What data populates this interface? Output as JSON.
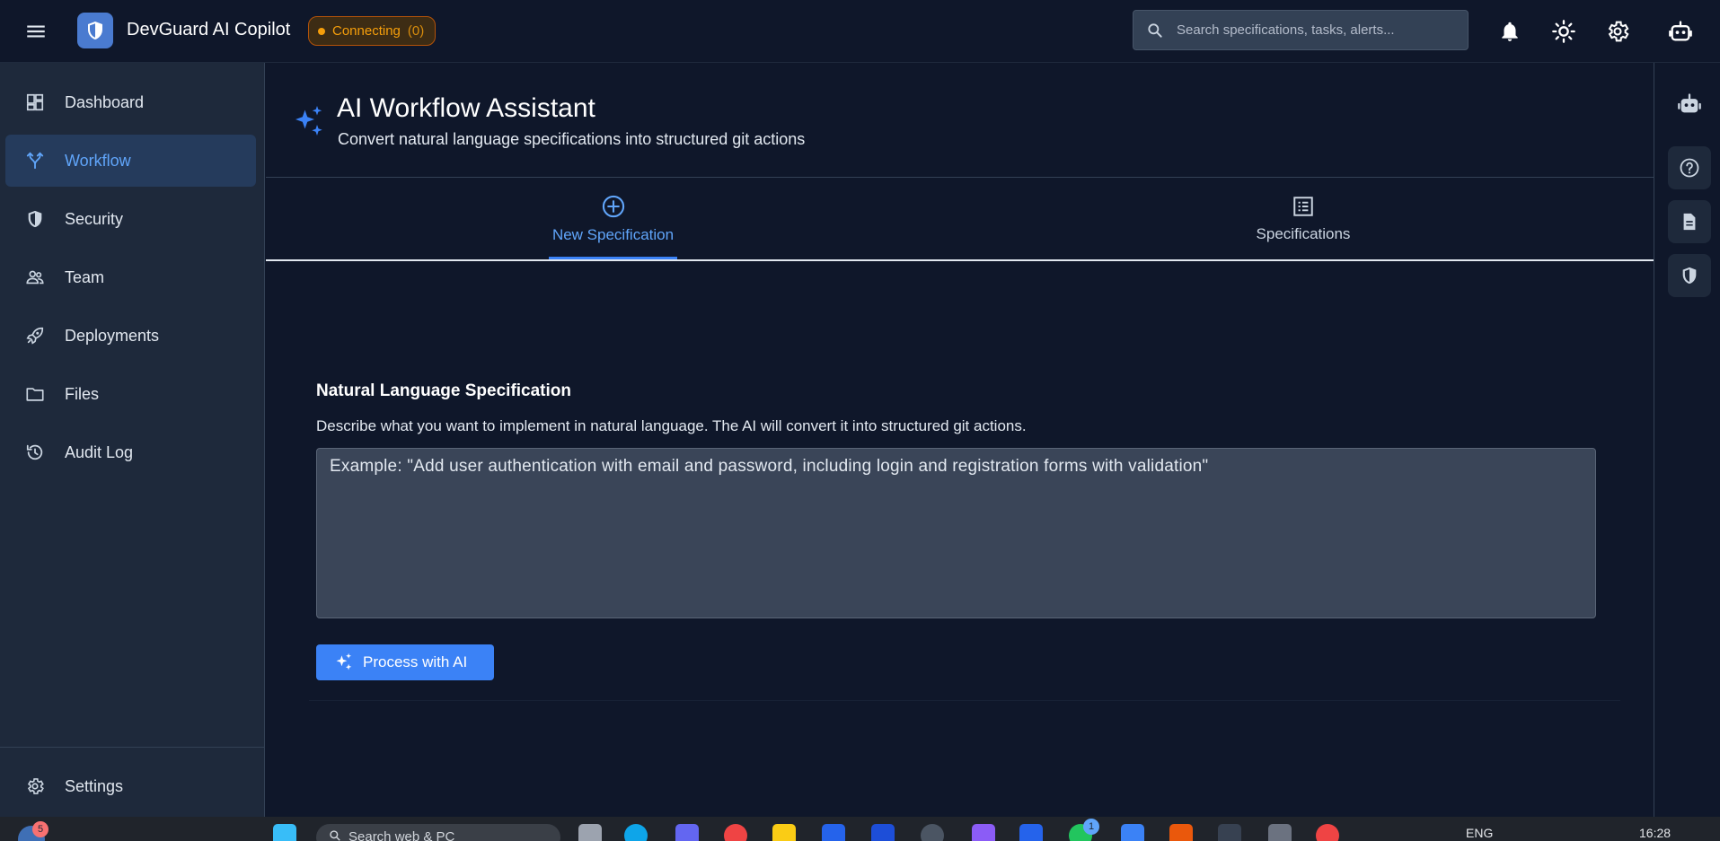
{
  "app": {
    "title": "DevGuard AI Copilot",
    "connection_status": "Connecting",
    "connection_count": "(0)"
  },
  "search": {
    "placeholder": "Search specifications, tasks, alerts..."
  },
  "topbar_icons": [
    "menu-icon",
    "shield-logo-icon",
    "bell-icon",
    "sun-icon",
    "gear-icon",
    "robot-icon"
  ],
  "sidebar": {
    "items": [
      {
        "label": "Dashboard",
        "icon": "dashboard-icon"
      },
      {
        "label": "Workflow",
        "icon": "merge-icon",
        "active": true
      },
      {
        "label": "Security",
        "icon": "shield-icon"
      },
      {
        "label": "Team",
        "icon": "people-icon"
      },
      {
        "label": "Deployments",
        "icon": "rocket-icon"
      },
      {
        "label": "Files",
        "icon": "folder-icon"
      },
      {
        "label": "Audit Log",
        "icon": "history-icon"
      }
    ],
    "settings_label": "Settings"
  },
  "right_rail": [
    "robot-icon",
    "help-icon",
    "document-icon",
    "shield-icon"
  ],
  "page": {
    "title": "AI Workflow Assistant",
    "subtitle": "Convert natural language specifications into structured git actions"
  },
  "tabs": [
    {
      "label": "New Specification",
      "icon": "add-circle-icon",
      "active": true
    },
    {
      "label": "Specifications",
      "icon": "list-icon"
    }
  ],
  "spec": {
    "title": "Natural Language Specification",
    "description": "Describe what you want to implement in natural language. The AI will convert it into structured git actions.",
    "placeholder": "Example: \"Add user authentication with email and password, including login and registration forms with validation\"",
    "value": "",
    "button_label": "Process with AI"
  },
  "taskbar": {
    "notification_count": "5",
    "search_text": "Search web & PC",
    "badge_count": "1",
    "language": "ENG",
    "time": "16:28"
  },
  "colors": {
    "accent": "#3b82f6",
    "active_text": "#60a5fa",
    "background": "#0f172a",
    "sidebar": "#1e293b",
    "warning": "#f59e0b"
  }
}
